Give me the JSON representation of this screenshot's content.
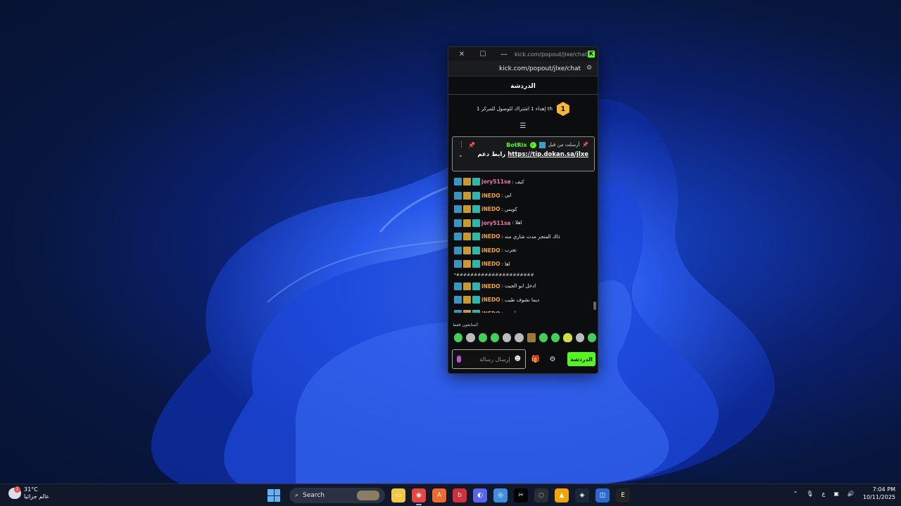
{
  "window": {
    "title": "kick.com/popout/jlxe/chat -",
    "address": "kick.com/popout/jlxe/chat"
  },
  "chat": {
    "header": "الدردشة",
    "goal_text": "إهداء 1 اشتراك للوصول للمركز 1 th",
    "goal_rank": "1",
    "pinned": {
      "sent_label": "أرسلت من قبل",
      "bot_name": "BotRix",
      "message_prefix": "رابط دعم",
      "link": "https://tip.dokan.sa/jlxe"
    },
    "messages": [
      {
        "user": "jory511sa",
        "color": "#f573a8",
        "text": "كيف"
      },
      {
        "user": "iNEDO",
        "color": "#f5a623",
        "text": "ابي"
      },
      {
        "user": "iNEDO",
        "color": "#f5a623",
        "text": "كويس"
      },
      {
        "user": "jory511sa",
        "color": "#f573a8",
        "text": "اهلا"
      },
      {
        "user": "iNEDO",
        "color": "#f5a623",
        "text": "ذاك المتجر مدت شاري منه"
      },
      {
        "user": "iNEDO",
        "color": "#f5a623",
        "text": "تجرب"
      },
      {
        "user": "iNEDO",
        "color": "#f5a623",
        "text": "اها"
      },
      {
        "text_only": "*######################"
      },
      {
        "user": "iNEDO",
        "color": "#f5a623",
        "text": "ادخل ابو الجيت"
      },
      {
        "user": "iNEDO",
        "color": "#f5a623",
        "text": "ديما نشوف طيب"
      },
      {
        "user": "iNEDO",
        "color": "#f5a623",
        "text": "يا جوه"
      }
    ],
    "emote_label": "المتابعون فقط",
    "input_placeholder": "إرسال رسالة",
    "send_label": "الدردشة"
  },
  "taskbar": {
    "temperature": "31°C",
    "weather_label": "عالم جزائيا",
    "weather_badge": "2",
    "search_label": "Search",
    "lang": "ع",
    "time": "7:04 PM",
    "date": "10/11/2025"
  },
  "colors": {
    "accent": "#53fc18",
    "goal_coin": "#f5b82e"
  }
}
